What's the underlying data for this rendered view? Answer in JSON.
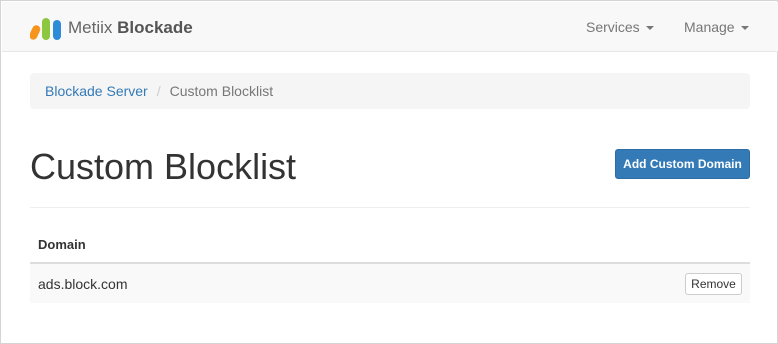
{
  "navbar": {
    "brand_light": "Metiix",
    "brand_bold": "Blockade",
    "menu": [
      {
        "label": "Services"
      },
      {
        "label": "Manage"
      }
    ]
  },
  "breadcrumb": {
    "link": "Blockade Server",
    "active": "Custom Blocklist"
  },
  "page": {
    "title": "Custom Blocklist",
    "add_button": "Add Custom Domain"
  },
  "table": {
    "header": "Domain",
    "rows": [
      {
        "domain": "ads.block.com",
        "action": "Remove"
      }
    ]
  },
  "colors": {
    "primary": "#337ab7",
    "navbar_bg": "#f8f8f8",
    "logo_orange": "#f7941d",
    "logo_green": "#8dc63f",
    "logo_blue": "#2e8bd8"
  }
}
